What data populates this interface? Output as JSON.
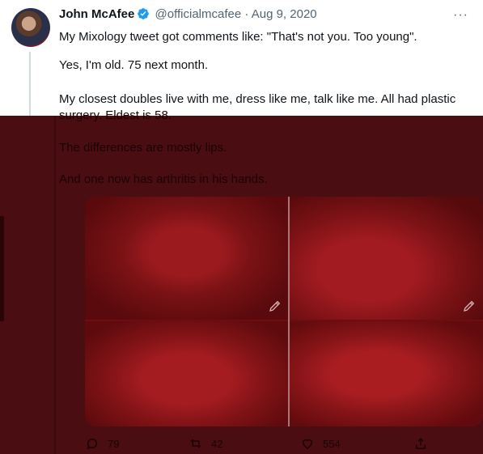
{
  "tweet": {
    "author_name": "John McAfee",
    "handle": "@officialmcafee",
    "separator": "·",
    "date": "Aug 9, 2020",
    "more_label": "···",
    "lines": [
      "My Mixology tweet got comments like: \"That's not you. Too young\".",
      "Yes, I'm old. 75 next month.",
      "My closest doubles live with me, dress like me, talk like me. All had plastic",
      "surgery. Eldest is 58.",
      "The differences are mostly lips.",
      "And one now has arthritis in his hands."
    ]
  },
  "actions": {
    "reply_count": "79",
    "retweet_count": "42",
    "like_count": "554"
  },
  "colors": {
    "verified": "#1d9bf0",
    "overlay": "#4a0d11",
    "handle": "#536471"
  },
  "icons": [
    "verified-badge-icon",
    "more-icon",
    "reply-icon",
    "retweet-icon",
    "like-icon",
    "share-icon",
    "edit-pencil-icon"
  ]
}
